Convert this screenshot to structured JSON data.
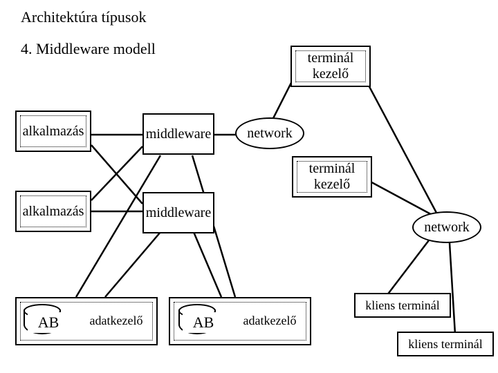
{
  "title": "Architektúra típusok",
  "subtitle": "4. Middleware  modell",
  "labels": {
    "app1": "alkalmazás",
    "app2": "alkalmazás",
    "mw1": "middleware",
    "mw2": "middleware",
    "term1a": "terminál",
    "term1b": "kezelő",
    "term2a": "terminál",
    "term2b": "kezelő",
    "net1": "network",
    "net2": "network",
    "ab1": "AB",
    "ab2": "AB",
    "data1": "adatkezelő",
    "data2": "adatkezelő",
    "client1": "kliens terminál",
    "client2": "kliens terminál"
  }
}
